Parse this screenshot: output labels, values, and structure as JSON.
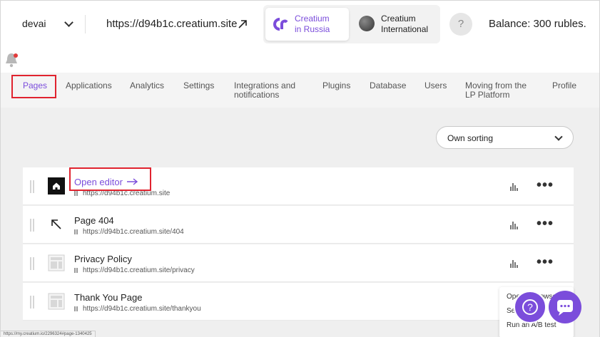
{
  "header": {
    "project": "devai",
    "site_url": "https://d94b1c.creatium.site",
    "regions": [
      {
        "label": "Creatium\nin Russia",
        "line1": "Creatium",
        "line2": "in Russia",
        "selected": true
      },
      {
        "label": "Creatium International",
        "line1": "Creatium",
        "line2": "International",
        "selected": false
      }
    ],
    "help": "?",
    "balance": "Balance: 300 rubles."
  },
  "nav": {
    "items": [
      {
        "label": "Pages",
        "active": true
      },
      {
        "label": "Applications"
      },
      {
        "label": "Analytics"
      },
      {
        "label": "Settings"
      },
      {
        "label": "Integrations and",
        "label2": "notifications"
      },
      {
        "label": "Plugins"
      },
      {
        "label": "Database"
      },
      {
        "label": "Users"
      },
      {
        "label": "Moving from the",
        "label2": "LP Platform"
      },
      {
        "label": "Profile"
      }
    ]
  },
  "sort": {
    "label": "Own sorting"
  },
  "pages": [
    {
      "title": "Open editor",
      "url": "https://d94b1c.creatium.site",
      "icon": "home-icon"
    },
    {
      "title": "Page 404",
      "url": "https://d94b1c.creatium.site/404",
      "icon": "arrow-up-left-icon"
    },
    {
      "title": "Privacy Policy",
      "url": "https://d94b1c.creatium.site/privacy",
      "icon": "page-layout-icon"
    },
    {
      "title": "Thank You Page",
      "url": "https://d94b1c.creatium.site/thankyou",
      "icon": "page-layout-icon"
    }
  ],
  "context_menu": {
    "items": [
      "Open in browser",
      "Se",
      "Run an A/B test"
    ]
  },
  "statusbar": "https://my.creatium.io/2296324#page-1340425",
  "colors": {
    "accent": "#7b4ddb",
    "highlight": "#e0232f"
  }
}
